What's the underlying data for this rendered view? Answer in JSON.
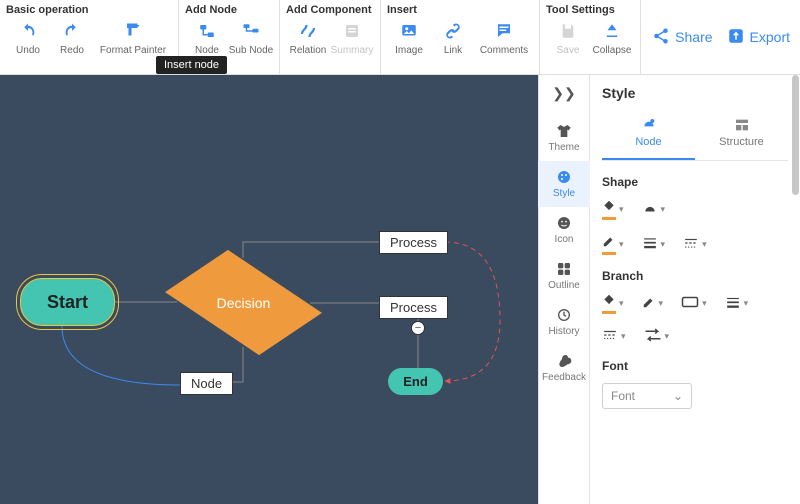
{
  "toolbar": {
    "groups": {
      "basic": {
        "title": "Basic operation",
        "undo": "Undo",
        "redo": "Redo",
        "formatPainter": "Format Painter"
      },
      "addNode": {
        "title": "Add Node",
        "node": "Node",
        "subNode": "Sub Node"
      },
      "addComp": {
        "title": "Add Component",
        "relation": "Relation",
        "summary": "Summary"
      },
      "insert": {
        "title": "Insert",
        "image": "Image",
        "link": "Link",
        "comments": "Comments"
      },
      "tool": {
        "title": "Tool Settings",
        "save": "Save",
        "collapse": "Collapse"
      }
    },
    "share": "Share",
    "export": "Export",
    "tooltip": "Insert node"
  },
  "canvas": {
    "start": "Start",
    "decision": "Decision",
    "process1": "Process",
    "process2": "Process",
    "node": "Node",
    "end": "End"
  },
  "rail": {
    "theme": "Theme",
    "style": "Style",
    "icon": "Icon",
    "outline": "Outline",
    "history": "History",
    "feedback": "Feedback"
  },
  "panel": {
    "title": "Style",
    "tabNode": "Node",
    "tabStructure": "Structure",
    "sectionShape": "Shape",
    "sectionBranch": "Branch",
    "sectionFont": "Font",
    "fontValue": "Font"
  }
}
